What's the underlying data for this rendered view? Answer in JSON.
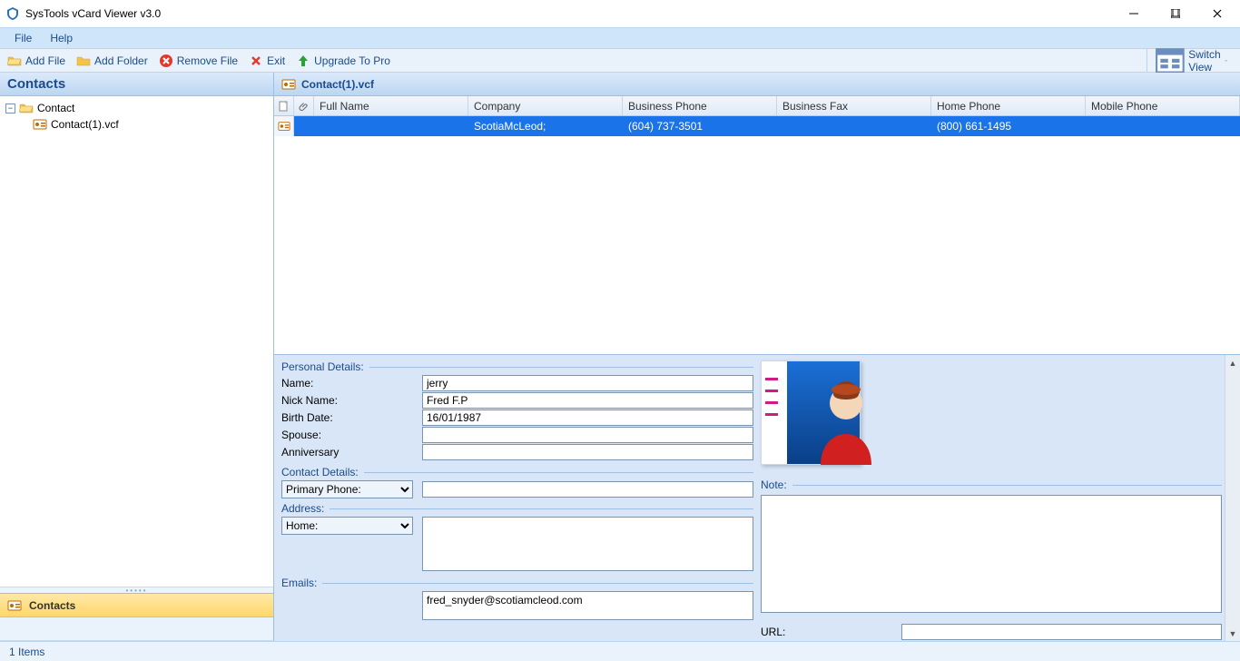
{
  "window": {
    "title": "SysTools vCard Viewer v3.0"
  },
  "menu": {
    "file": "File",
    "help": "Help"
  },
  "toolbar": {
    "add_file": "Add File",
    "add_folder": "Add Folder",
    "remove_file": "Remove File",
    "exit": "Exit",
    "upgrade": "Upgrade To Pro",
    "switch_view": "Switch View"
  },
  "sidebar": {
    "header": "Contacts",
    "tree": {
      "root": "Contact",
      "items": [
        "Contact(1).vcf"
      ]
    },
    "nav": {
      "contacts": "Contacts"
    }
  },
  "main": {
    "header": "Contact(1).vcf",
    "columns": {
      "full_name": "Full Name",
      "company": "Company",
      "business_phone": "Business Phone",
      "business_fax": "Business Fax",
      "home_phone": "Home Phone",
      "mobile_phone": "Mobile Phone"
    },
    "rows": [
      {
        "full_name": "",
        "company": "ScotiaMcLeod;",
        "business_phone": "(604) 737-3501",
        "business_fax": "",
        "home_phone": "(800) 661-1495",
        "mobile_phone": ""
      }
    ]
  },
  "details": {
    "personal": {
      "title": "Personal Details:",
      "name_label": "Name:",
      "name": "jerry",
      "nick_label": "Nick Name:",
      "nick": "Fred F.P",
      "birth_label": "Birth Date:",
      "birth": "16/01/1987",
      "spouse_label": "Spouse:",
      "spouse": "",
      "anniv_label": "Anniversary",
      "anniv": ""
    },
    "contact": {
      "title": "Contact Details:",
      "primary_phone_label": "Primary Phone:",
      "primary_phone": ""
    },
    "address": {
      "title": "Address:",
      "type_label": "Home:",
      "value": ""
    },
    "emails": {
      "title": "Emails:",
      "value": "fred_snyder@scotiamcleod.com"
    },
    "note": {
      "title": "Note:"
    },
    "url": {
      "title": "URL:"
    }
  },
  "status": {
    "items": "1 Items"
  }
}
